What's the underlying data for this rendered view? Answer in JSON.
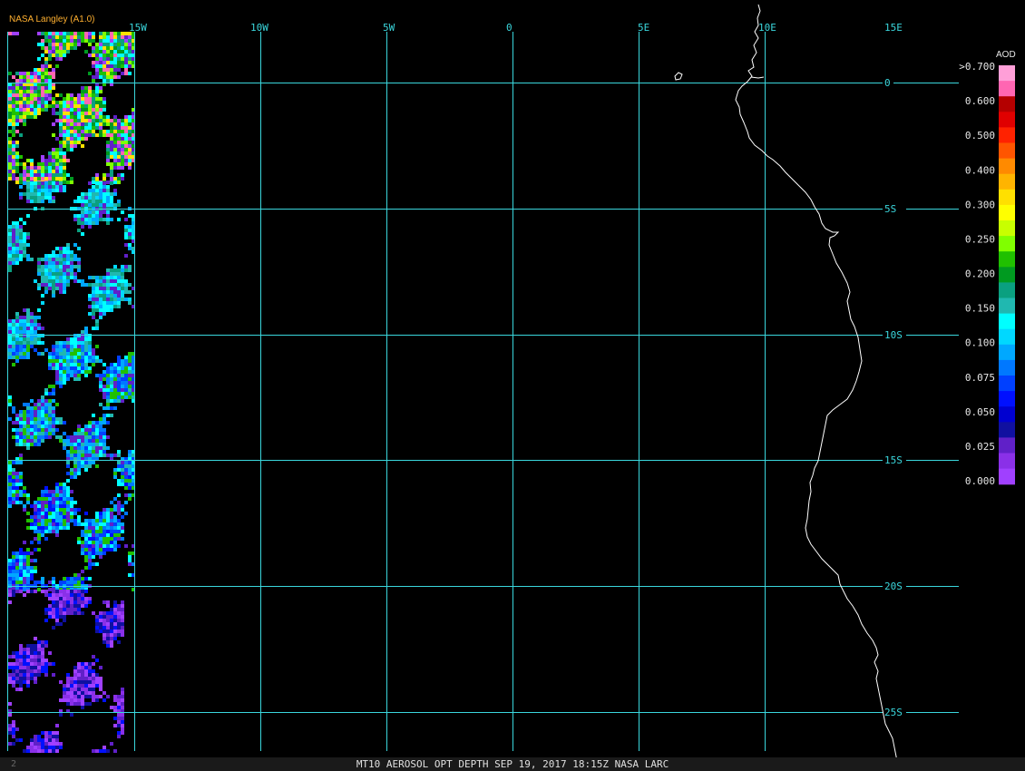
{
  "credit": "NASA Langley (A1.0)",
  "footer": {
    "title": "MT10  AEROSOL OPT DEPTH   SEP 19, 2017 18:15Z   NASA LARC",
    "frame_number": "2"
  },
  "map": {
    "lon_labels": [
      "15W",
      "10W",
      "5W",
      "0",
      "5E",
      "10E",
      "15E"
    ],
    "lat_labels": [
      "0",
      "5S",
      "10S",
      "15S",
      "20S",
      "25S"
    ],
    "grid_color": "#3ad6dc",
    "coastline_color": "#ffffff"
  },
  "legend": {
    "title": "AOD",
    "ticks": [
      ">0.700",
      "0.600",
      "0.500",
      "0.400",
      "0.300",
      "0.250",
      "0.200",
      "0.150",
      "0.100",
      "0.075",
      "0.050",
      "0.025",
      "0.000"
    ],
    "colors": [
      "#ff9fd8",
      "#ff66b2",
      "#b40000",
      "#e00000",
      "#ff2200",
      "#ff5500",
      "#ff8a00",
      "#ffb400",
      "#ffe000",
      "#ffff00",
      "#c8ff00",
      "#80ff00",
      "#20c000",
      "#009a20",
      "#0aa080",
      "#20b8b0",
      "#00ffff",
      "#00d8ff",
      "#00a8ff",
      "#0078ff",
      "#0040ff",
      "#0010ff",
      "#0000d0",
      "#1010a0",
      "#6020c8",
      "#8a30e8",
      "#a040ff"
    ]
  }
}
